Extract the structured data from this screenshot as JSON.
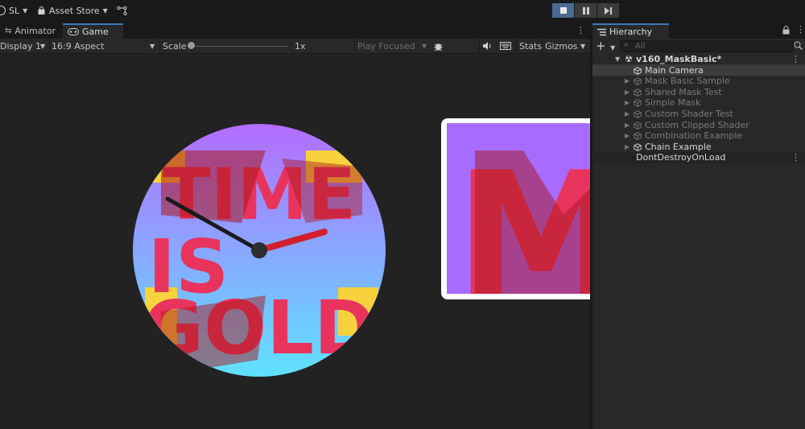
{
  "toolbar": {
    "account_label": "SL",
    "asset_store_label": "Asset Store",
    "colors": {
      "play_active": "#4a6a92",
      "tab_accent": "#3a79bb"
    }
  },
  "tabs": {
    "animator": "Animator",
    "game": "Game",
    "hierarchy": "Hierarchy"
  },
  "game_toolbar": {
    "display": "Display 1",
    "aspect": "16:9 Aspect",
    "scale_label": "Scale",
    "scale_value": "1x",
    "play_mode": "Play Focused",
    "stats": "Stats",
    "gizmos": "Gizmos"
  },
  "game_view": {
    "clock_text": [
      "TIME",
      "IS",
      "GOLD"
    ],
    "zoom_letter": "M"
  },
  "hierarchy": {
    "search_placeholder": "All",
    "scene": "v160_MaskBasic*",
    "items": [
      {
        "label": "Main Camera",
        "enabled": true,
        "expandable": false,
        "selected": true
      },
      {
        "label": "Mask Basic Sample",
        "enabled": false,
        "expandable": true
      },
      {
        "label": "Shared Mask Test",
        "enabled": false,
        "expandable": true
      },
      {
        "label": "Simple Mask",
        "enabled": false,
        "expandable": true
      },
      {
        "label": "Custom Shader Test",
        "enabled": false,
        "expandable": true
      },
      {
        "label": "Custom Clipped Shader",
        "enabled": false,
        "expandable": true
      },
      {
        "label": "Combination Example",
        "enabled": false,
        "expandable": true
      },
      {
        "label": "Chain Example",
        "enabled": true,
        "expandable": true
      }
    ],
    "dont_destroy": "DontDestroyOnLoad"
  }
}
